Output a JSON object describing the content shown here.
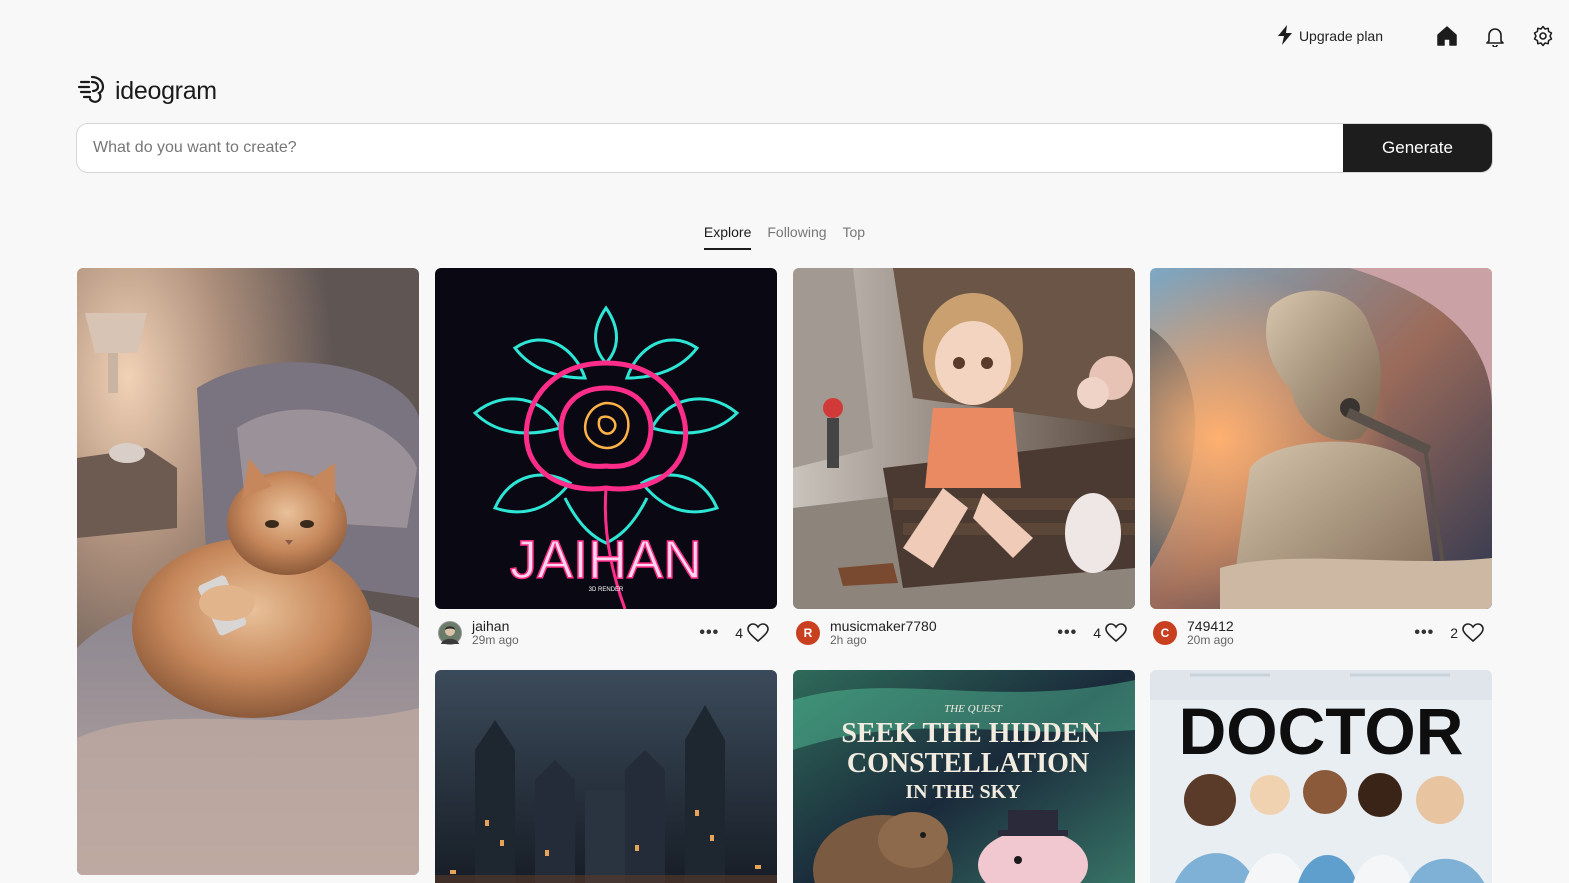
{
  "nav": {
    "upgrade_label": "Upgrade plan",
    "icons": [
      "lightning-icon",
      "home-icon",
      "bell-icon",
      "gear-icon"
    ]
  },
  "logo": {
    "text": "ideogram"
  },
  "search": {
    "placeholder": "What do you want to create?",
    "value": "",
    "button": "Generate"
  },
  "tabs": [
    {
      "label": "Explore",
      "active": true
    },
    {
      "label": "Following",
      "active": false
    },
    {
      "label": "Top",
      "active": false
    }
  ],
  "posts": [
    {
      "user": "jaihan",
      "time": "29m ago",
      "likes": "4",
      "avatar_color": "#6b7b6a",
      "image_text": "JAIHAN",
      "image_subtext": "3D RENDER"
    },
    {
      "user": "musicmaker7780",
      "time": "2h ago",
      "likes": "4",
      "avatar_initial": "R",
      "avatar_color": "#c8401f"
    },
    {
      "user": "749412",
      "time": "20m ago",
      "likes": "2",
      "avatar_initial": "C",
      "avatar_color": "#c8401f"
    }
  ],
  "row2": {
    "poster_small": "THE QUEST",
    "poster_line1": "SEEK THE HIDDEN",
    "poster_line2": "CONSTELLATION",
    "poster_line3": "IN THE SKY",
    "doctor": "DOCTOR"
  },
  "colors": {
    "accent": "#1d1d1d",
    "background": "#f8f8f8",
    "neon_pink": "#ff2d8a",
    "neon_teal": "#2ee6d6"
  }
}
